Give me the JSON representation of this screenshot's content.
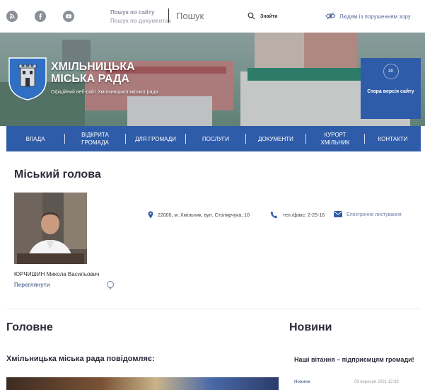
{
  "search": {
    "tab_site": "Пошук по сайту",
    "tab_docs": "Пошук по документах",
    "placeholder": "Пошук",
    "button_label": "Знайти"
  },
  "accessibility": {
    "label": "Людям із порушенням зору"
  },
  "header": {
    "title_line1": "ХМІЛЬНИЦЬКА",
    "title_line2": "МІСЬКА РАДА",
    "subtitle": "Офіційний веб-сайт Хмільницької міської ради",
    "old_version": "Стара версія сайту",
    "old_version_icon_text": "20"
  },
  "nav": {
    "items": [
      {
        "label": "Влада"
      },
      {
        "label": "Відкрита громада"
      },
      {
        "label": "Для громади"
      },
      {
        "label": "Послуги"
      },
      {
        "label": "Документи"
      },
      {
        "label": "Курорт Хмільник"
      },
      {
        "label": "Контакти"
      }
    ]
  },
  "mayor": {
    "heading": "Міський голова",
    "name": "ЮРЧИШИН Микола Васильович",
    "view_label": "Переглянути",
    "address": "22000, м. Хмільник, вул. Столярчука, 10",
    "phone": "тел./факс: 2-25-16",
    "email": "Електронне листування"
  },
  "main": {
    "heading": "Головне",
    "subheading": "Хмільницька міська рада повідомляє:"
  },
  "news": {
    "heading": "Новини",
    "item_title": "Наші вітання – підприємцям громади!",
    "item_category": "Новини",
    "item_date": "09 вересня 2021 12:38"
  },
  "colors": {
    "brand_blue": "#2f5ca8",
    "link_muted": "#6a7ba0"
  },
  "icons": [
    "rss-icon",
    "facebook-icon",
    "youtube-icon",
    "search-icon",
    "eye-icon",
    "location-icon",
    "phone-icon",
    "mail-icon",
    "arrow-right-icon"
  ]
}
